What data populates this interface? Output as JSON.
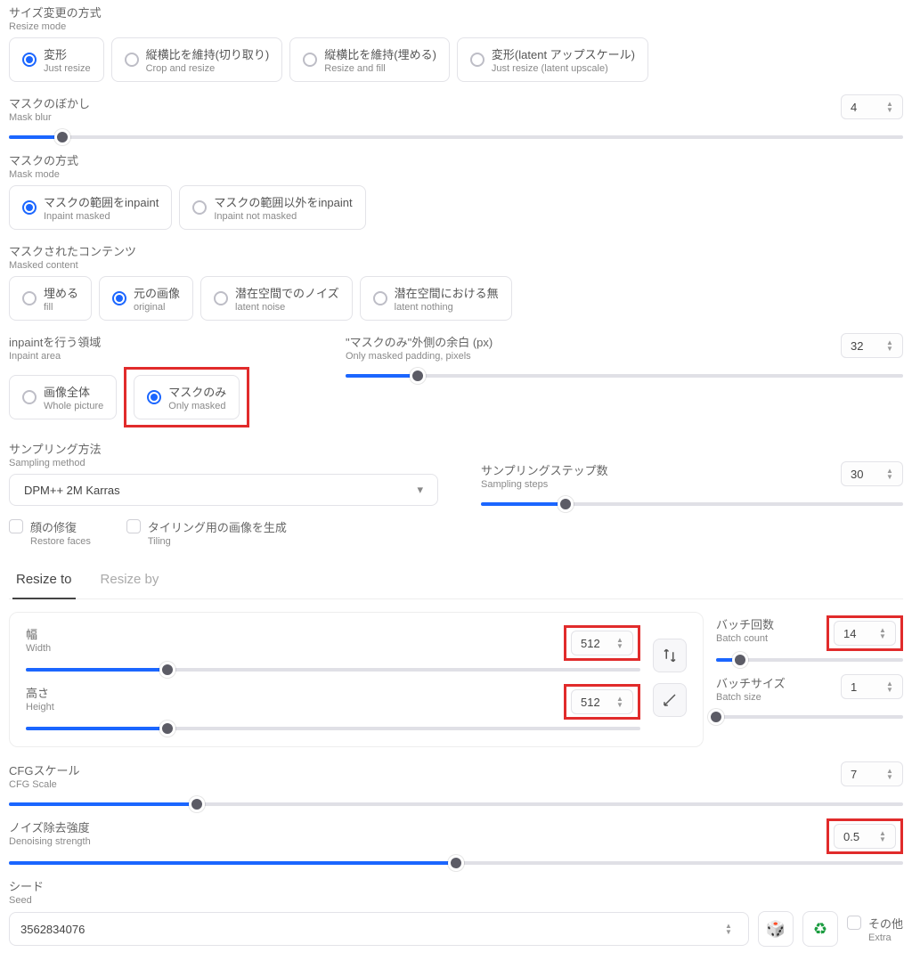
{
  "resize_mode": {
    "jp": "サイズ変更の方式",
    "en": "Resize mode",
    "options": [
      {
        "jp": "変形",
        "en": "Just resize",
        "selected": true
      },
      {
        "jp": "縦横比を維持(切り取り)",
        "en": "Crop and resize",
        "selected": false
      },
      {
        "jp": "縦横比を維持(埋める)",
        "en": "Resize and fill",
        "selected": false
      },
      {
        "jp": "変形(latent アップスケール)",
        "en": "Just resize (latent upscale)",
        "selected": false
      }
    ]
  },
  "mask_blur": {
    "jp": "マスクのぼかし",
    "en": "Mask blur",
    "value": "4",
    "pct": 6
  },
  "mask_mode": {
    "jp": "マスクの方式",
    "en": "Mask mode",
    "options": [
      {
        "jp": "マスクの範囲をinpaint",
        "en": "Inpaint masked",
        "selected": true
      },
      {
        "jp": "マスクの範囲以外をinpaint",
        "en": "Inpaint not masked",
        "selected": false
      }
    ]
  },
  "masked_content": {
    "jp": "マスクされたコンテンツ",
    "en": "Masked content",
    "options": [
      {
        "jp": "埋める",
        "en": "fill",
        "selected": false
      },
      {
        "jp": "元の画像",
        "en": "original",
        "selected": true
      },
      {
        "jp": "潜在空間でのノイズ",
        "en": "latent noise",
        "selected": false
      },
      {
        "jp": "潜在空間における無",
        "en": "latent nothing",
        "selected": false
      }
    ]
  },
  "inpaint_area": {
    "jp": "inpaintを行う領域",
    "en": "Inpaint area",
    "options": [
      {
        "jp": "画像全体",
        "en": "Whole picture",
        "selected": false
      },
      {
        "jp": "マスクのみ",
        "en": "Only masked",
        "selected": true
      }
    ]
  },
  "only_masked_padding": {
    "jp": "\"マスクのみ\"外側の余白 (px)",
    "en": "Only masked padding, pixels",
    "value": "32",
    "pct": 13
  },
  "sampling_method": {
    "jp": "サンプリング方法",
    "en": "Sampling method",
    "value": "DPM++ 2M Karras"
  },
  "sampling_steps": {
    "jp": "サンプリングステップ数",
    "en": "Sampling steps",
    "value": "30",
    "pct": 20
  },
  "restore_faces": {
    "jp": "顔の修復",
    "en": "Restore faces"
  },
  "tiling": {
    "jp": "タイリング用の画像を生成",
    "en": "Tiling"
  },
  "tabs": {
    "resize_to": "Resize to",
    "resize_by": "Resize by"
  },
  "width": {
    "jp": "幅",
    "en": "Width",
    "value": "512",
    "pct": 23
  },
  "height": {
    "jp": "高さ",
    "en": "Height",
    "value": "512",
    "pct": 23
  },
  "batch_count": {
    "jp": "バッチ回数",
    "en": "Batch count",
    "value": "14",
    "pct": 13
  },
  "batch_size": {
    "jp": "バッチサイズ",
    "en": "Batch size",
    "value": "1",
    "pct": 0
  },
  "cfg_scale": {
    "jp": "CFGスケール",
    "en": "CFG Scale",
    "value": "7",
    "pct": 21
  },
  "denoising": {
    "jp": "ノイズ除去強度",
    "en": "Denoising strength",
    "value": "0.5",
    "pct": 50
  },
  "seed": {
    "jp": "シード",
    "en": "Seed",
    "value": "3562834076"
  },
  "extra": {
    "jp": "その他",
    "en": "Extra"
  }
}
